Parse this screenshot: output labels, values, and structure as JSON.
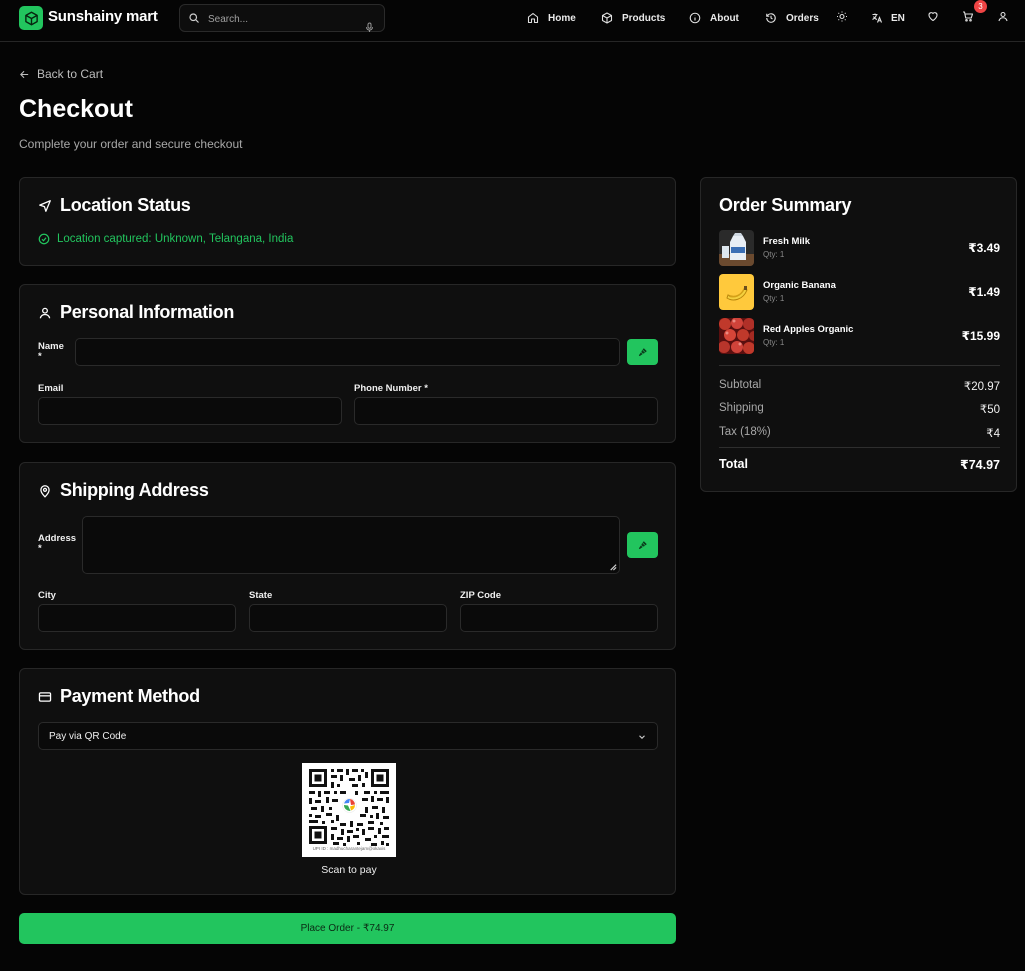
{
  "header": {
    "brand": "Sunshainy mart",
    "search_placeholder": "Search...",
    "nav": [
      {
        "label": "Home",
        "icon": "home-icon"
      },
      {
        "label": "Products",
        "icon": "box-icon"
      },
      {
        "label": "About",
        "icon": "info-icon"
      },
      {
        "label": "Orders",
        "icon": "history-icon"
      }
    ],
    "language": "EN",
    "cart_count": "3"
  },
  "page": {
    "back_label": "Back to Cart",
    "title": "Checkout",
    "subtitle": "Complete your order and secure checkout"
  },
  "location": {
    "title": "Location Status",
    "status": "Location captured: Unknown, Telangana, India"
  },
  "personal": {
    "title": "Personal Information",
    "name_label": "Name *",
    "email_label": "Email",
    "phone_label": "Phone Number *"
  },
  "shipping": {
    "title": "Shipping Address",
    "address_label": "Address *",
    "city_label": "City",
    "state_label": "State",
    "zip_label": "ZIP Code"
  },
  "payment": {
    "title": "Payment Method",
    "selected": "Pay via QR Code",
    "qr_upi": "UPI ID : madhucharantejam@okaxis",
    "scan_label": "Scan to pay"
  },
  "place_order": {
    "label": "Place Order - ",
    "amount": "₹74.97"
  },
  "summary": {
    "title": "Order Summary",
    "items": [
      {
        "name": "Fresh Milk",
        "qty": "Qty: 1",
        "price": "₹3.49"
      },
      {
        "name": "Organic Banana",
        "qty": "Qty: 1",
        "price": "₹1.49"
      },
      {
        "name": "Red Apples Organic",
        "qty": "Qty: 1",
        "price": "₹15.99"
      }
    ],
    "subtotal_label": "Subtotal",
    "subtotal": "₹20.97",
    "shipping_label": "Shipping",
    "shipping": "₹50",
    "tax_label": "Tax (18%)",
    "tax": "₹4",
    "total_label": "Total",
    "total": "₹74.97"
  },
  "colors": {
    "accent": "#22c55e",
    "background": "#050505",
    "card": "#0f0f0f",
    "badge": "#ef4444"
  }
}
